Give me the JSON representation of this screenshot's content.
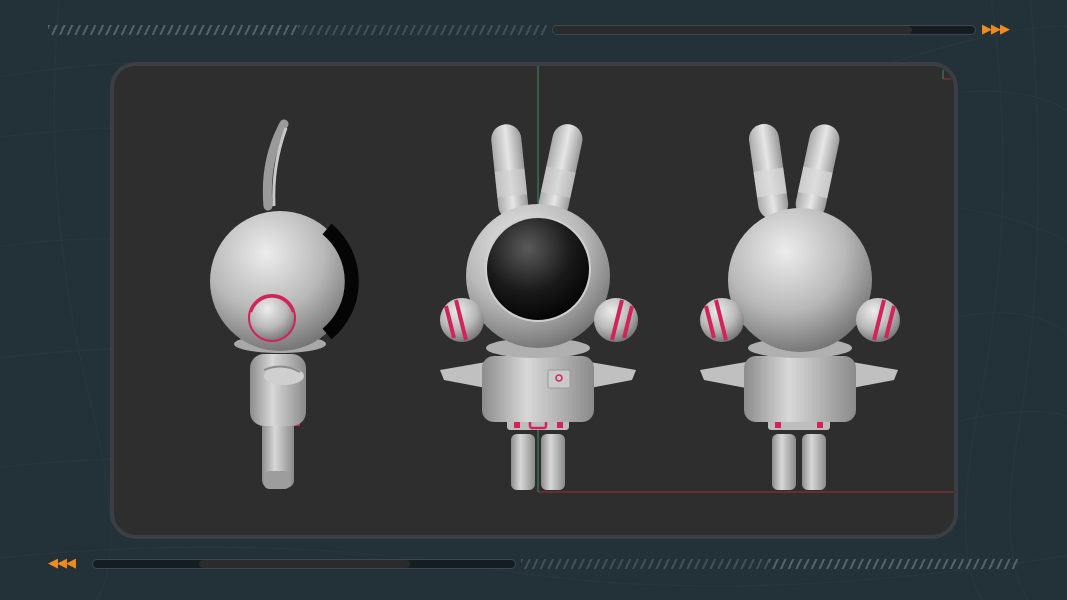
{
  "theme": {
    "background": "#233139",
    "accent": "#f08a1c",
    "panel": "#2e2e2e",
    "panel_border": "#3a3f43",
    "suit_stripe": "#d3245a",
    "axis_green": "#3f8a6a",
    "axis_red": "#9a2f3c"
  },
  "header": {
    "arrows": "▶▶▶",
    "icon": "play-arrows-icon",
    "progress": 0.85
  },
  "footer": {
    "arrows": "◀◀◀",
    "icon": "rewind-arrows-icon",
    "progress": 0.25
  },
  "viewport": {
    "icon": "axis-gizmo-icon",
    "views": [
      {
        "name": "side-view",
        "icon": "astronaut-bunny-side-icon"
      },
      {
        "name": "front-view",
        "icon": "astronaut-bunny-front-icon"
      },
      {
        "name": "back-view",
        "icon": "astronaut-bunny-back-icon"
      }
    ]
  }
}
